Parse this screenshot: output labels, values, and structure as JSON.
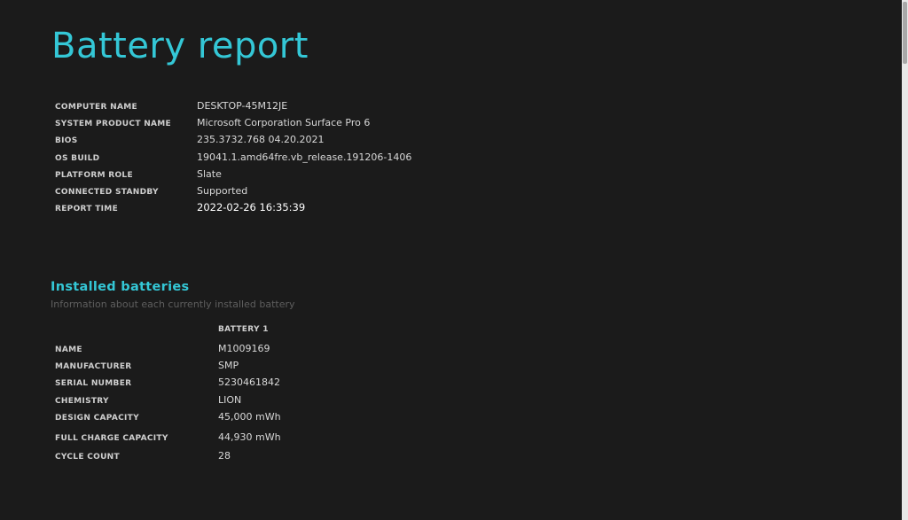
{
  "title": "Battery report",
  "system_info": [
    {
      "label": "COMPUTER NAME",
      "value": "DESKTOP-45M12JE"
    },
    {
      "label": "SYSTEM PRODUCT NAME",
      "value": "Microsoft Corporation Surface Pro 6"
    },
    {
      "label": "BIOS",
      "value": "235.3732.768 04.20.2021"
    },
    {
      "label": "OS BUILD",
      "value": "19041.1.amd64fre.vb_release.191206-1406"
    },
    {
      "label": "PLATFORM ROLE",
      "value": "Slate"
    },
    {
      "label": "CONNECTED STANDBY",
      "value": "Supported"
    },
    {
      "label": "REPORT TIME",
      "value": "2022-02-26  16:35:39"
    }
  ],
  "installed_batteries": {
    "title": "Installed batteries",
    "subtitle": "Information about each currently installed battery",
    "column_header": "BATTERY 1",
    "rows": [
      {
        "label": "NAME",
        "value": "M1009169"
      },
      {
        "label": "MANUFACTURER",
        "value": "SMP"
      },
      {
        "label": "SERIAL NUMBER",
        "value": "5230461842"
      },
      {
        "label": "CHEMISTRY",
        "value": "LION"
      },
      {
        "label": "DESIGN CAPACITY",
        "value": "45,000 mWh"
      },
      {
        "label": "FULL CHARGE CAPACITY",
        "value": "44,930 mWh"
      },
      {
        "label": "CYCLE COUNT",
        "value": "28"
      }
    ]
  },
  "colors": {
    "background": "#1b1b1b",
    "accent": "#34c7d6",
    "label": "#cfcfcf",
    "value": "#d8d8d8",
    "subtitle": "#5e5e5e"
  }
}
